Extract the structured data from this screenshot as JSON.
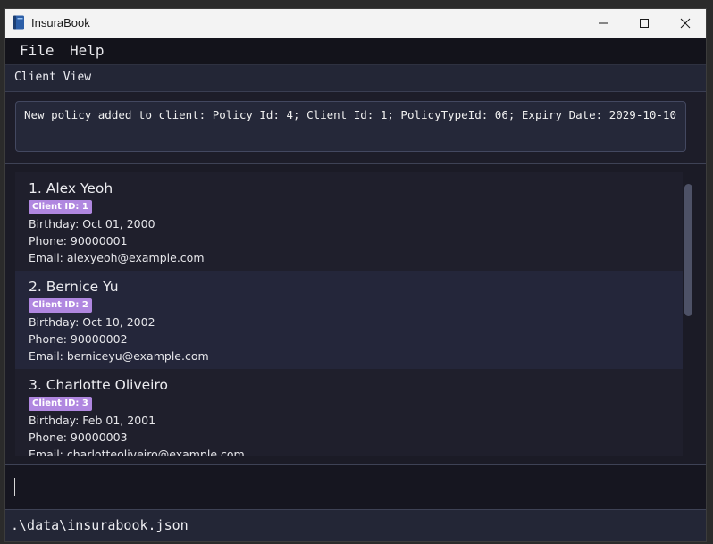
{
  "window": {
    "title": "InsuraBook"
  },
  "menu": {
    "items": [
      "File",
      "Help"
    ]
  },
  "view": {
    "label": "Client View"
  },
  "result": {
    "message": "New policy added to client: Policy Id: 4; Client Id: 1; PolicyTypeId: 06; Expiry Date: 2029-10-10"
  },
  "clients": [
    {
      "name": "1. Alex Yeoh",
      "badge": "Client ID: 1",
      "birthday": "Birthday: Oct 01, 2000",
      "phone": "Phone: 90000001",
      "email": "Email: alexyeoh@example.com"
    },
    {
      "name": "2. Bernice Yu",
      "badge": "Client ID: 2",
      "birthday": "Birthday: Oct 10, 2002",
      "phone": "Phone: 90000002",
      "email": "Email: berniceyu@example.com"
    },
    {
      "name": "3. Charlotte Oliveiro",
      "badge": "Client ID: 3",
      "birthday": "Birthday: Feb 01, 2001",
      "phone": "Phone: 90000003",
      "email": "Email: charlotteoliveiro@example.com"
    }
  ],
  "command": {
    "value": "",
    "placeholder": ""
  },
  "status": {
    "path": ".\\data\\insurabook.json"
  },
  "colors": {
    "badge": "#b087e0",
    "background": "#1b1b26",
    "accent": "#232636"
  }
}
